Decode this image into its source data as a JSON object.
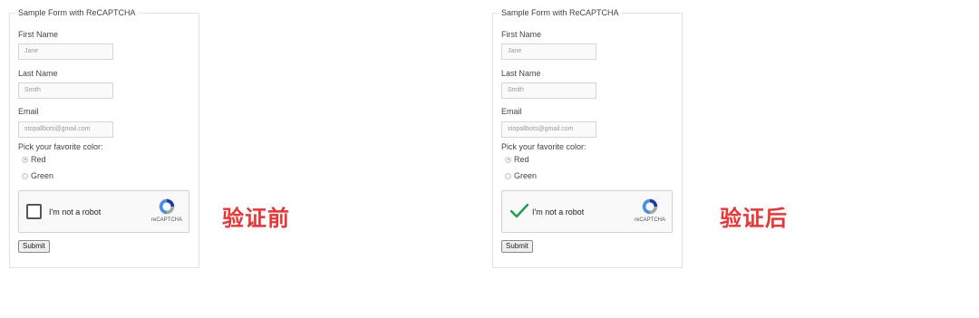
{
  "before": {
    "legend": "Sample Form with ReCAPTCHA",
    "first_name": {
      "label": "First Name",
      "value": "Jane"
    },
    "last_name": {
      "label": "Last Name",
      "value": "Smith"
    },
    "email": {
      "label": "Email",
      "value": "stopallbots@gmail.com"
    },
    "color_prompt": "Pick your favorite color:",
    "color_options": [
      {
        "label": "Red",
        "selected": true
      },
      {
        "label": "Green",
        "selected": false
      }
    ],
    "captcha": {
      "label": "I'm not a robot",
      "brand": "reCAPTCHA",
      "verified": false
    },
    "submit_label": "Submit",
    "caption": "验证前"
  },
  "after": {
    "legend": "Sample Form with ReCAPTCHA",
    "first_name": {
      "label": "First Name",
      "value": "Jane"
    },
    "last_name": {
      "label": "Last Name",
      "value": "Smith"
    },
    "email": {
      "label": "Email",
      "value": "stopallbots@gmail.com"
    },
    "color_prompt": "Pick your favorite color:",
    "color_options": [
      {
        "label": "Red",
        "selected": true
      },
      {
        "label": "Green",
        "selected": false
      }
    ],
    "captcha": {
      "label": "I'm not a robot",
      "brand": "reCAPTCHA",
      "verified": true
    },
    "submit_label": "Submit",
    "caption": "验证后"
  },
  "colors": {
    "caption": "#ee3333",
    "checkmark": "#1e9e4a",
    "recaptcha_blue": "#4a90e2",
    "recaptcha_dark": "#1c3aa9"
  }
}
